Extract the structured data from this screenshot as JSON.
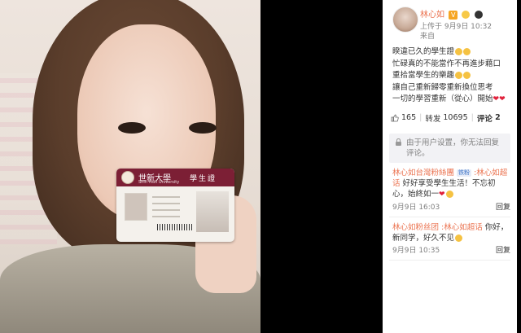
{
  "photo": {
    "card": {
      "school_name": "世新大學",
      "school_name_en": "Shih Hsin University",
      "card_type": "學生證"
    }
  },
  "post": {
    "username": "林心如",
    "vip_badge": "V",
    "upload_time": "上传于 9月9日 10:32",
    "source": "来自",
    "lines": [
      "睽違已久的學生證",
      "忙碌真的不能當作不再進步藉口",
      "重拾當學生的樂趣",
      "讓自己重新歸零重新換位思考",
      "一切的學習重新（從心）開始"
    ]
  },
  "actions": {
    "likes": "165",
    "repost_label": "转发",
    "repost_count": "10695",
    "comment_label": "评论",
    "comment_count": "2"
  },
  "notice": {
    "text": "由于用户设置，你无法回复评论。"
  },
  "comments": [
    {
      "user": "林心如台灣粉絲團",
      "tag": "铁粉",
      "mention": ":林心如超话",
      "text": "好好享受學生生活！不忘初心，始終如一",
      "time": "9月9日 16:03",
      "reply": "回复"
    },
    {
      "user": "林心如粉丝团",
      "tag": "",
      "mention": ":林心如超话",
      "text": "你好，新同学，好久不见",
      "time": "9月9日 10:35",
      "reply": "回复"
    }
  ],
  "colors": {
    "username": "#eb7350",
    "meta": "#808080",
    "card_band": "#7c1f35"
  },
  "icons": {
    "like": "thumbs-up-icon",
    "notice": "lock-icon"
  }
}
